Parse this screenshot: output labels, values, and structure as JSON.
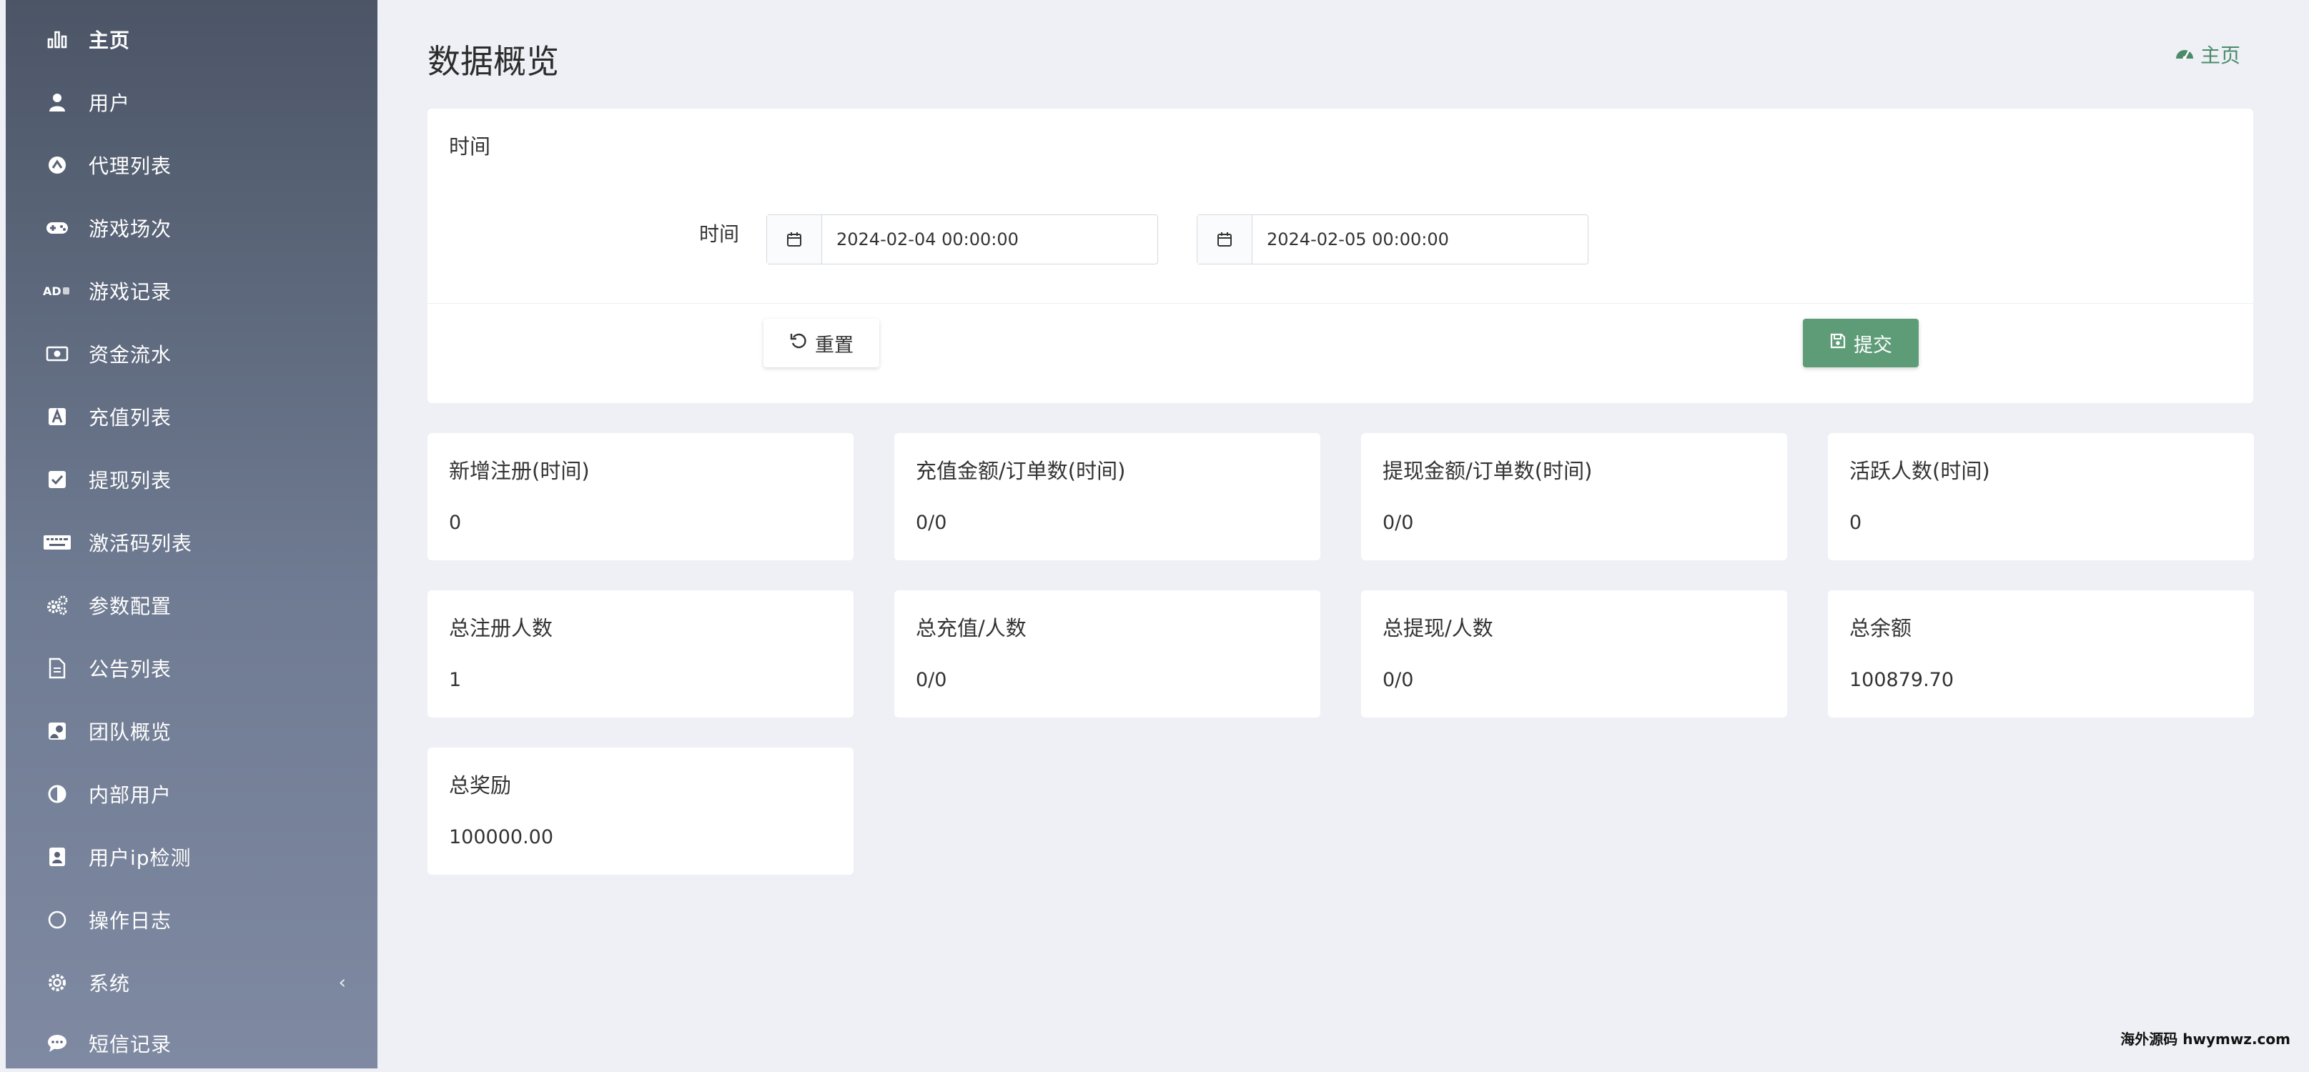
{
  "sidebar": {
    "items": [
      {
        "label": "主页",
        "icon": "bar-chart-icon"
      },
      {
        "label": "用户",
        "icon": "user-icon"
      },
      {
        "label": "代理列表",
        "icon": "agent-circle-icon"
      },
      {
        "label": "游戏场次",
        "icon": "gamepad-icon"
      },
      {
        "label": "游戏记录",
        "icon": "ad-icon"
      },
      {
        "label": "资金流水",
        "icon": "money-icon"
      },
      {
        "label": "充值列表",
        "icon": "letter-a-icon"
      },
      {
        "label": "提现列表",
        "icon": "check-square-icon"
      },
      {
        "label": "激活码列表",
        "icon": "keyboard-icon"
      },
      {
        "label": "参数配置",
        "icon": "gears-icon"
      },
      {
        "label": "公告列表",
        "icon": "document-icon"
      },
      {
        "label": "团队概览",
        "icon": "team-icon"
      },
      {
        "label": "内部用户",
        "icon": "half-circle-icon"
      },
      {
        "label": "用户ip检测",
        "icon": "id-badge-icon"
      },
      {
        "label": "操作日志",
        "icon": "circle-icon"
      },
      {
        "label": "系统",
        "icon": "gear-icon"
      },
      {
        "label": "短信记录",
        "icon": "chat-icon"
      }
    ],
    "system_chevron": "‹"
  },
  "header": {
    "title": "数据概览",
    "breadcrumb": "主页",
    "breadcrumb_icon": "dashboard-icon"
  },
  "filter": {
    "panel_title": "时间",
    "label": "时间",
    "start": "2024-02-04 00:00:00",
    "end": "2024-02-05 00:00:00",
    "reset_label": "重置",
    "submit_label": "提交"
  },
  "stats": [
    {
      "title": "新增注册(时间)",
      "value": "0"
    },
    {
      "title": "充值金额/订单数(时间)",
      "value": "0/0"
    },
    {
      "title": "提现金额/订单数(时间)",
      "value": "0/0"
    },
    {
      "title": "活跃人数(时间)",
      "value": "0"
    },
    {
      "title": "总注册人数",
      "value": "1"
    },
    {
      "title": "总充值/人数",
      "value": "0/0"
    },
    {
      "title": "总提现/人数",
      "value": "0/0"
    },
    {
      "title": "总余额",
      "value": "100879.70"
    },
    {
      "title": "总奖励",
      "value": "100000.00"
    }
  ],
  "watermark": "海外源码 hwymwz.com",
  "colors": {
    "accent": "#5e9c78",
    "sidebar_top": "#4b5566",
    "sidebar_bottom": "#7f8aa2",
    "background": "#eef0f5"
  }
}
